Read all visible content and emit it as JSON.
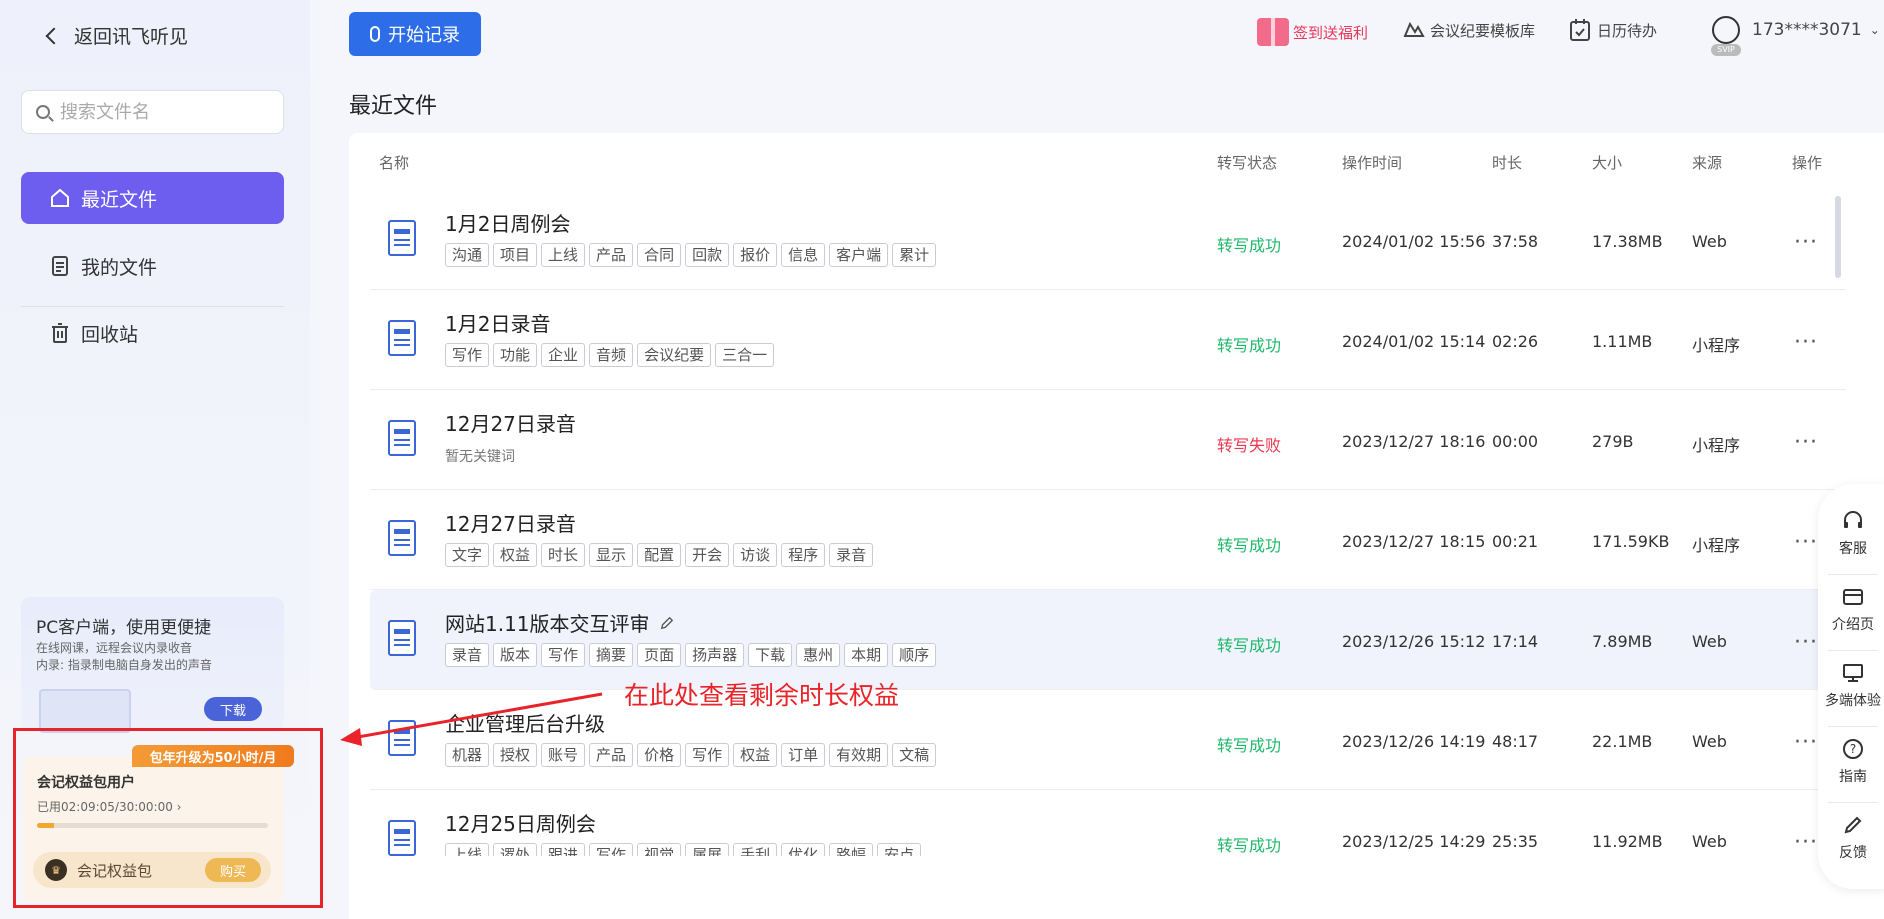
{
  "sidebar": {
    "back_label": "返回讯飞听见",
    "search_placeholder": "搜索文件名",
    "nav": [
      {
        "label": "最近文件",
        "icon": "home-icon",
        "active": true
      },
      {
        "label": "我的文件",
        "icon": "file-icon",
        "active": false
      },
      {
        "label": "回收站",
        "icon": "trash-icon",
        "active": false
      }
    ],
    "promo": {
      "title": "PC客户端，使用更便捷",
      "desc1": "在线网课，远程会议内录收音",
      "desc2": "内录: 指录制电脑自身发出的声音",
      "download": "下载"
    },
    "vip": {
      "badge": "包年升级为50小时/月",
      "title": "会记权益包用户",
      "used": "已用02:09:05/30:00:00",
      "used_fraction": 0.072,
      "pack_label": "会记权益包",
      "buy": "购买"
    }
  },
  "topbar": {
    "start_label": "开始记录",
    "gift_label": "签到送福利",
    "template_label": "会议纪要模板库",
    "calendar_label": "日历待办",
    "user": "173****3071",
    "vip_tag": "SVIP"
  },
  "main": {
    "title": "最近文件",
    "columns": {
      "name": "名称",
      "status": "转写状态",
      "time": "操作时间",
      "duration": "时长",
      "size": "大小",
      "source": "来源",
      "action": "操作"
    },
    "rows": [
      {
        "name": "1月2日周例会",
        "tags": [
          "沟通",
          "项目",
          "上线",
          "产品",
          "合同",
          "回款",
          "报价",
          "信息",
          "客户端",
          "累计"
        ],
        "status": "转写成功",
        "status_ok": true,
        "time": "2024/01/02 15:56",
        "duration": "37:58",
        "size": "17.38MB",
        "source": "Web"
      },
      {
        "name": "1月2日录音",
        "tags": [
          "写作",
          "功能",
          "企业",
          "音频",
          "会议纪要",
          "三合一"
        ],
        "status": "转写成功",
        "status_ok": true,
        "time": "2024/01/02 15:14",
        "duration": "02:26",
        "size": "1.11MB",
        "source": "小程序"
      },
      {
        "name": "12月27日录音",
        "tags": [],
        "no_keywords": "暂无关键词",
        "status": "转写失败",
        "status_ok": false,
        "time": "2023/12/27 18:16",
        "duration": "00:00",
        "size": "279B",
        "source": "小程序"
      },
      {
        "name": "12月27日录音",
        "tags": [
          "文字",
          "权益",
          "时长",
          "显示",
          "配置",
          "开会",
          "访谈",
          "程序",
          "录音"
        ],
        "status": "转写成功",
        "status_ok": true,
        "time": "2023/12/27 18:15",
        "duration": "00:21",
        "size": "171.59KB",
        "source": "小程序"
      },
      {
        "name": "网站1.11版本交互评审",
        "tags": [
          "录音",
          "版本",
          "写作",
          "摘要",
          "页面",
          "扬声器",
          "下载",
          "惠州",
          "本期",
          "顺序"
        ],
        "status": "转写成功",
        "status_ok": true,
        "time": "2023/12/26 15:12",
        "duration": "17:14",
        "size": "7.89MB",
        "source": "Web"
      },
      {
        "name": "企业管理后台升级",
        "tags": [
          "机器",
          "授权",
          "账号",
          "产品",
          "价格",
          "写作",
          "权益",
          "订单",
          "有效期",
          "文稿"
        ],
        "status": "转写成功",
        "status_ok": true,
        "time": "2023/12/26 14:19",
        "duration": "48:17",
        "size": "22.1MB",
        "source": "Web"
      },
      {
        "name": "12月25日周例会",
        "tags": [
          "上线",
          "逻处",
          "跟进",
          "写作",
          "视觉",
          "属展",
          "手刮",
          "优化",
          "路幅",
          "安点"
        ],
        "status": "转写成功",
        "status_ok": true,
        "time": "2023/12/25 14:29",
        "duration": "25:35",
        "size": "11.92MB",
        "source": "Web"
      }
    ]
  },
  "annotation": "在此处查看剩余时长权益",
  "floatbar": [
    {
      "label": "客服",
      "icon": "headset-icon"
    },
    {
      "label": "介绍页",
      "icon": "card-icon"
    },
    {
      "label": "多端体验",
      "icon": "monitor-icon"
    },
    {
      "label": "指南",
      "icon": "help-icon"
    },
    {
      "label": "反馈",
      "icon": "pen-icon"
    }
  ],
  "colors": {
    "accent": "#6d5ef0",
    "primary_button": "#2e6de8",
    "success": "#1fb86b",
    "fail": "#e8384f",
    "annotation": "#e8232a"
  }
}
